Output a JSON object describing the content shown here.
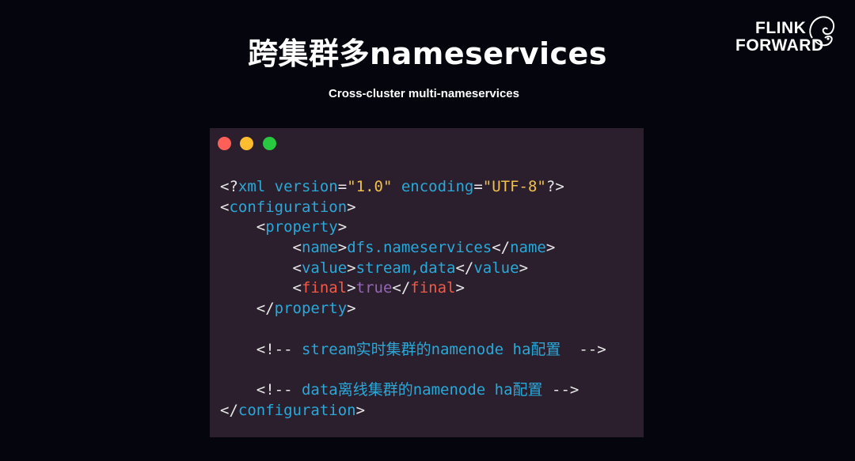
{
  "slide": {
    "title": "跨集群多nameservices",
    "subtitle": "Cross-cluster multi-nameservices"
  },
  "logo": {
    "line1": "FLINK",
    "line2": "FORWARD",
    "icon": "squirrel-icon"
  },
  "window": {
    "buttons": [
      "close",
      "minimize",
      "maximize"
    ],
    "colors": {
      "close": "#fe5f57",
      "minimize": "#febc2e",
      "maximize": "#28c840"
    }
  },
  "code": {
    "xml_decl_open": "<?",
    "xml_decl_name": "xml",
    "version_attr": " version",
    "version_val": "\"1.0\"",
    "encoding_attr": " encoding",
    "encoding_val": "\"UTF-8\"",
    "xml_decl_close": "?>",
    "root_tag": "configuration",
    "property_tag": "property",
    "name_tag": "name",
    "name_value": "dfs.nameservices",
    "value_tag": "value",
    "value_value": "stream,data",
    "final_tag": "final",
    "final_value": "true",
    "comment_open": "<!--",
    "comment_1": " stream实时集群的namenode ha配置  ",
    "comment_2": " data离线集群的namenode ha配置 ",
    "comment_close": "-->"
  },
  "colors": {
    "background": "#05050d",
    "code_bg": "#2b1f2d",
    "tag": "#2aa8d8",
    "string": "#f0c04a",
    "final_tag": "#f25a45",
    "boolean": "#9566b6"
  }
}
